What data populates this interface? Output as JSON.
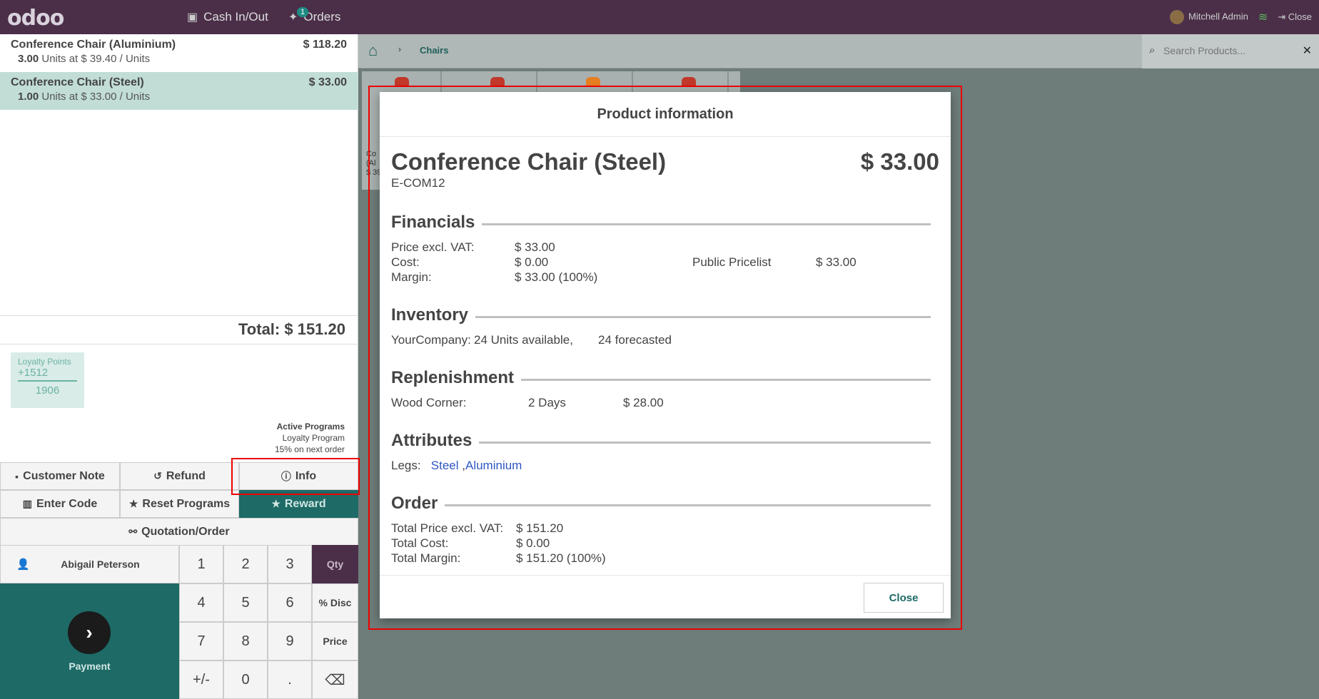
{
  "topbar": {
    "logo": "odoo",
    "cash_label": "Cash In/Out",
    "orders_label": "Orders",
    "orders_badge": "1",
    "user_name": "Mitchell Admin",
    "close_label": "Close"
  },
  "orderlines": [
    {
      "name": "Conference Chair (Aluminium)",
      "price": "$ 118.20",
      "qty": "3.00",
      "unit_info": "Units at $ 39.40 / Units"
    },
    {
      "name": "Conference Chair (Steel)",
      "price": "$ 33.00",
      "qty": "1.00",
      "unit_info": "Units at $ 33.00 / Units"
    }
  ],
  "total": "Total: $ 151.20",
  "loyalty": {
    "title": "Loyalty Points",
    "plus": "+1512",
    "total": "1906"
  },
  "active_programs": {
    "header": "Active Programs",
    "items": [
      "Loyalty Program",
      "15% on next order"
    ]
  },
  "controls": {
    "customer_note": "Customer Note",
    "refund": "Refund",
    "info": "Info",
    "enter_code": "Enter Code",
    "reset_programs": "Reset Programs",
    "reward": "Reward",
    "quotation": "Quotation/Order"
  },
  "customer": "Abigail Peterson",
  "payment_label": "Payment",
  "numpad": {
    "keys": [
      "1",
      "2",
      "3",
      "4",
      "5",
      "6",
      "7",
      "8",
      "9",
      "+/-",
      "0",
      "."
    ],
    "modes": [
      "Qty",
      "% Disc",
      "Price"
    ],
    "backspace": "⌫"
  },
  "breadcrumb": {
    "category": "Chairs"
  },
  "search": {
    "placeholder": "Search Products..."
  },
  "product_tiles": [
    {
      "text_top": "Co",
      "text_mid": "(Al",
      "text_bot": "$ 39",
      "color": "#c0392b"
    },
    {
      "color": "#c0392b"
    },
    {
      "color": "#e67e22"
    },
    {
      "color": "#c0392b"
    }
  ],
  "modal": {
    "title": "Product information",
    "product_name": "Conference Chair (Steel)",
    "product_code": "E-COM12",
    "product_price": "$ 33.00",
    "financials": {
      "title": "Financials",
      "price_label": "Price excl. VAT:",
      "price_value": "$ 33.00",
      "cost_label": "Cost:",
      "cost_value": "$ 0.00",
      "margin_label": "Margin:",
      "margin_value": "$ 33.00 (100%)",
      "pricelist_label": "Public Pricelist",
      "pricelist_value": "$ 33.00"
    },
    "inventory": {
      "title": "Inventory",
      "company": "YourCompany:",
      "available": "24 Units available,",
      "forecasted": "24 forecasted"
    },
    "replenishment": {
      "title": "Replenishment",
      "vendor": "Wood Corner:",
      "delay": "2 Days",
      "price": "$ 28.00"
    },
    "attributes": {
      "title": "Attributes",
      "label": "Legs:",
      "value1": "Steel",
      "sep": ",",
      "value2": "Aluminium"
    },
    "order": {
      "title": "Order",
      "total_price_label": "Total Price excl. VAT:",
      "total_price_value": "$ 151.20",
      "total_cost_label": "Total Cost:",
      "total_cost_value": "$ 0.00",
      "total_margin_label": "Total Margin:",
      "total_margin_value": "$ 151.20 (100%)"
    },
    "close_label": "Close"
  }
}
